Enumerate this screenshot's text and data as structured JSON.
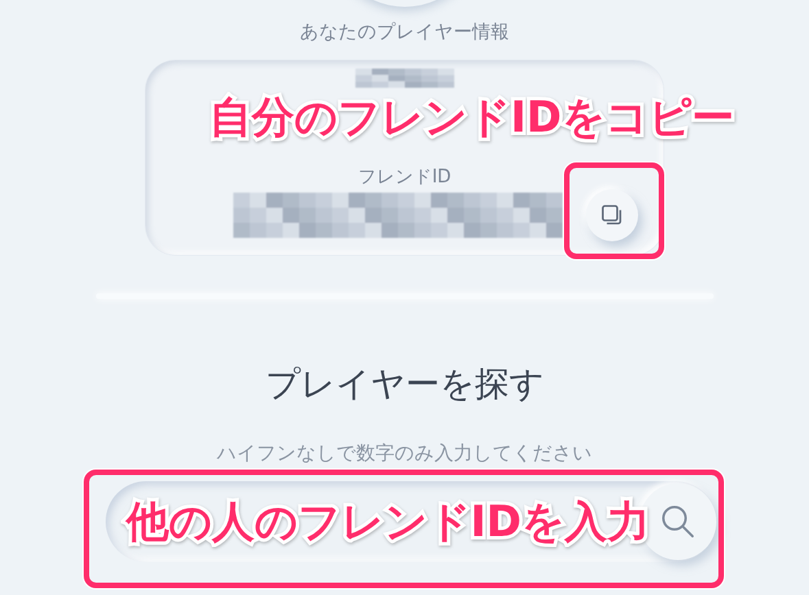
{
  "header": {
    "title": "あなたのプレイヤー情報"
  },
  "player_card": {
    "label": "フレンドID"
  },
  "search": {
    "title": "プレイヤーを探す",
    "hint": "ハイフンなしで数字のみ入力してください"
  },
  "annotations": [
    {
      "text": "自分のフレンドIDをコピー",
      "kind": "copy"
    },
    {
      "text": "他の人のフレンドIDを入力",
      "kind": "search"
    }
  ]
}
